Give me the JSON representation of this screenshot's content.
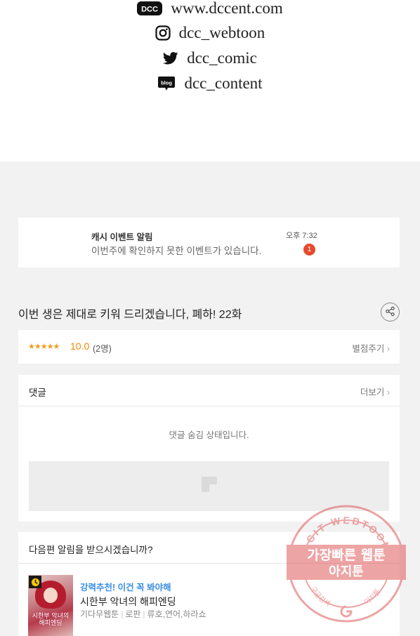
{
  "social": {
    "website": "www.dccent.com",
    "instagram": "dcc_webtoon",
    "twitter": "dcc_comic",
    "blog": "dcc_content",
    "logo_text": "DCC",
    "blog_icon_text": "blog"
  },
  "notification": {
    "title": "캐시 이벤트 알림",
    "message": "이번주에 확인하지 못한 이벤트가 있습니다.",
    "time": "오후 7:32",
    "badge_count": "1"
  },
  "episode": {
    "title": "이번 생은 제대로 키워 드리겠습니다, 폐하! 22화"
  },
  "rating": {
    "stars": "★★★★★",
    "score": "10.0",
    "count": "(2명)",
    "rate_link": "별점주기"
  },
  "comments": {
    "label": "댓글",
    "more": "더보기",
    "hidden_message": "댓글 숨김 상태입니다."
  },
  "next_episode": {
    "label": "다음편 알림을 받으시겠습니까?",
    "recommend": "강력추천! 이건 꼭 봐야해",
    "webtoon_title": "시한부 악녀의 해피엔딩",
    "meta": [
      "기다무웹툰",
      "로판",
      "류호,연어,하라쇼"
    ],
    "thumb_caption": "시한부 악녀의 해피엔딩"
  },
  "watermark": {
    "top_arc": "AGIT WEBTOON",
    "main": "가장빠른 웹툰",
    "sub": "아지툰",
    "left_small": "구글검색",
    "right_small": "아지툰"
  },
  "colors": {
    "accent_orange": "#f08a00",
    "badge_red": "#e64a2e",
    "link_blue": "#3a8ee6",
    "watermark_red": "#e05a5a"
  }
}
